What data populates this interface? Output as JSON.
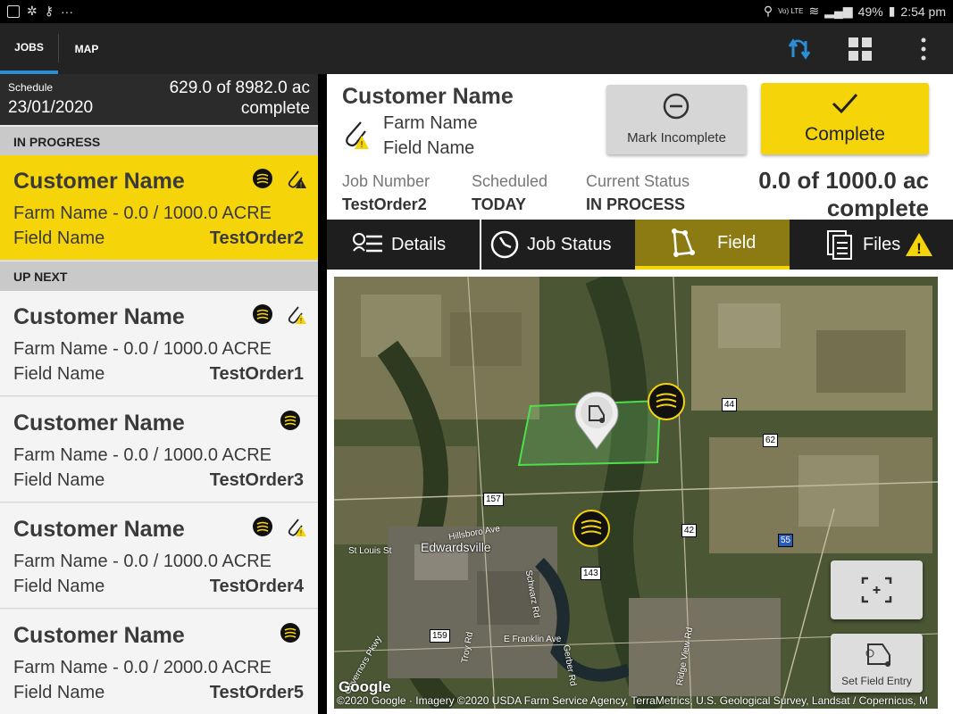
{
  "status_bar": {
    "time": "2:54 pm",
    "battery": "49%",
    "network": "Vo) LTE"
  },
  "top_tabs": [
    {
      "label": "JOBS"
    },
    {
      "label": "MAP"
    }
  ],
  "schedule": {
    "label": "Schedule",
    "date": "23/01/2020",
    "progress_line1": "629.0 of 8982.0 ac",
    "progress_line2": "complete"
  },
  "sections": {
    "in_progress": "IN PROGRESS",
    "up_next": "UP NEXT"
  },
  "jobs": [
    {
      "customer": "Customer Name",
      "farm": "Farm Name - 0.0 / 1000.0 ACRE",
      "field": "Field Name",
      "order": "TestOrder2",
      "has_warning": true
    },
    {
      "customer": "Customer Name",
      "farm": "Farm Name - 0.0 / 1000.0 ACRE",
      "field": "Field Name",
      "order": "TestOrder1",
      "has_warning": true
    },
    {
      "customer": "Customer Name",
      "farm": "Farm Name - 0.0 / 1000.0 ACRE",
      "field": "Field Name",
      "order": "TestOrder3",
      "has_warning": false
    },
    {
      "customer": "Customer Name",
      "farm": "Farm Name - 0.0 / 1000.0 ACRE",
      "field": "Field Name",
      "order": "TestOrder4",
      "has_warning": true
    },
    {
      "customer": "Customer Name",
      "farm": "Farm Name - 0.0 / 2000.0 ACRE",
      "field": "Field Name",
      "order": "TestOrder5",
      "has_warning": false
    }
  ],
  "detail": {
    "customer": "Customer Name",
    "farm": "Farm Name",
    "field": "Field Name",
    "mark_incomplete": "Mark Incomplete",
    "complete": "Complete",
    "job_number_label": "Job Number",
    "job_number": "TestOrder2",
    "scheduled_label": "Scheduled",
    "scheduled": "TODAY",
    "status_label": "Current Status",
    "status": "IN PROCESS",
    "acres_line1": "0.0 of 1000.0 ac",
    "acres_line2": "complete"
  },
  "detail_tabs": [
    {
      "label": "Details"
    },
    {
      "label": "Job Status"
    },
    {
      "label": "Field"
    },
    {
      "label": "Files"
    }
  ],
  "map": {
    "city": "Edwardsville",
    "labels": [
      "St Louis St",
      "Hillsboro Ave",
      "Schwarz Rd",
      "E Franklin Ave",
      "Troy Rd",
      "Gerber Rd",
      "Ridge View Rd",
      "Governors Pkwy"
    ],
    "shields": [
      "44",
      "62",
      "157",
      "42",
      "55",
      "143",
      "159"
    ],
    "set_field_entry": "Set Field Entry",
    "google": "Google",
    "attribution": "©2020 Google · Imagery ©2020 USDA Farm Service Agency, TerraMetrics, U.S. Geological Survey, Landsat / Copernicus, M"
  },
  "colors": {
    "accent_yellow": "#f6d40a",
    "tab_blue": "#2a8fd6",
    "dark": "#232323"
  }
}
